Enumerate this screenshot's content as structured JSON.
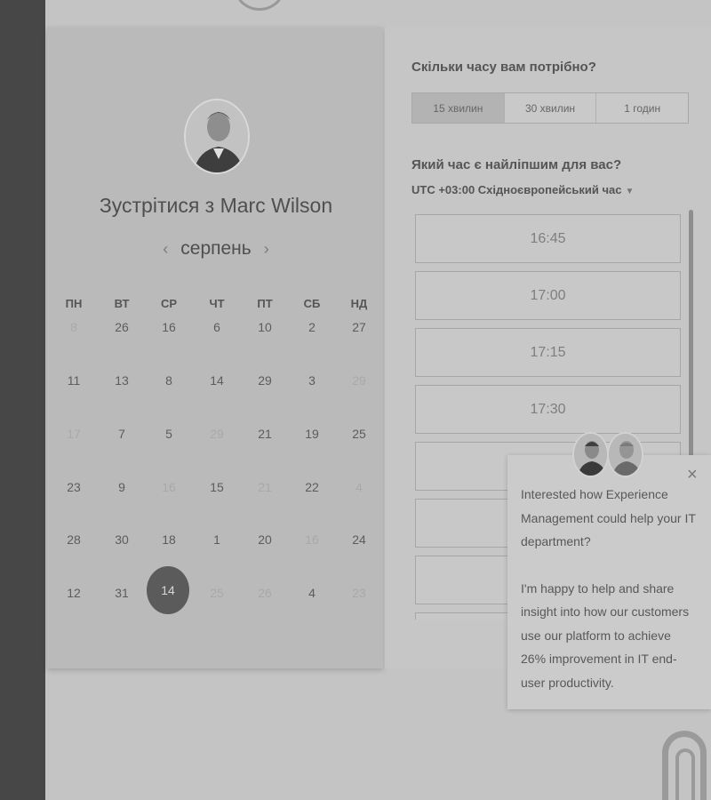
{
  "booking": {
    "title": "Зустрітися з Marc Wilson",
    "month": "серпень",
    "prev_icon": "‹",
    "next_icon": "›",
    "weekdays": [
      "ПН",
      "ВТ",
      "СР",
      "ЧТ",
      "ПТ",
      "СБ",
      "НД"
    ],
    "weeks": [
      [
        {
          "d": "8",
          "m": true
        },
        {
          "d": "26"
        },
        {
          "d": "16"
        },
        {
          "d": "6"
        },
        {
          "d": "10"
        },
        {
          "d": "2"
        },
        {
          "d": "27"
        }
      ],
      [
        {
          "d": "11"
        },
        {
          "d": "13"
        },
        {
          "d": "8"
        },
        {
          "d": "14"
        },
        {
          "d": "29"
        },
        {
          "d": "3"
        },
        {
          "d": "29",
          "m": true
        }
      ],
      [
        {
          "d": "17",
          "m": true
        },
        {
          "d": "7"
        },
        {
          "d": "5"
        },
        {
          "d": "29",
          "m": true
        },
        {
          "d": "21"
        },
        {
          "d": "19"
        },
        {
          "d": "25"
        }
      ],
      [
        {
          "d": "23"
        },
        {
          "d": "9"
        },
        {
          "d": "16",
          "m": true
        },
        {
          "d": "15"
        },
        {
          "d": "21",
          "m": true
        },
        {
          "d": "22"
        },
        {
          "d": "4",
          "m": true
        }
      ],
      [
        {
          "d": "28"
        },
        {
          "d": "30"
        },
        {
          "d": "18"
        },
        {
          "d": "1"
        },
        {
          "d": "20"
        },
        {
          "d": "16",
          "m": true
        },
        {
          "d": "24"
        }
      ],
      [
        {
          "d": "12"
        },
        {
          "d": "31"
        },
        {
          "d": "14",
          "sel": true
        },
        {
          "d": "25",
          "m": true
        },
        {
          "d": "26",
          "m": true
        },
        {
          "d": "4"
        },
        {
          "d": "23",
          "m": true
        }
      ]
    ]
  },
  "duration": {
    "question": "Скільки часу вам потрібно?",
    "options": [
      "15 хвилин",
      "30 хвилин",
      "1 годин"
    ]
  },
  "time": {
    "question": "Який час є найліпшим для вас?",
    "timezone": "UTC +03:00 Східноєвропейський час",
    "slots": [
      "16:45",
      "17:00",
      "17:15",
      "17:30",
      "",
      "",
      ""
    ]
  },
  "chat": {
    "line1": "Interested how Experience Management could help your IT department?",
    "line2": "I'm happy to help and share insight into how our customers use our platform to achieve 26% improvement in IT end-user productivity.",
    "close": "×"
  }
}
